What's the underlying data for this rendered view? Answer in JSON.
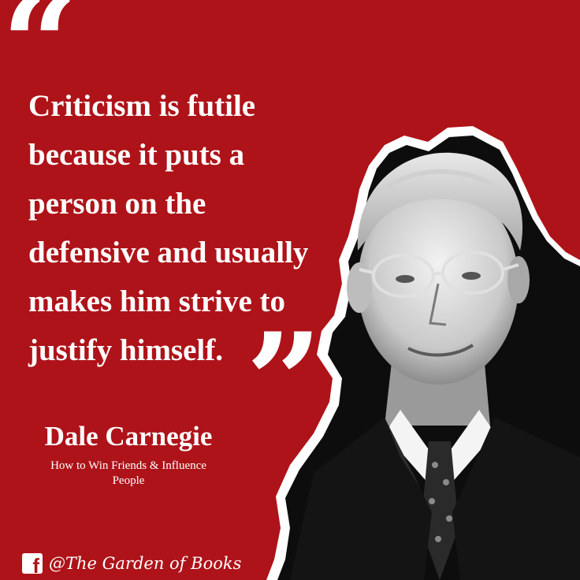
{
  "quote": {
    "open_mark": "“",
    "close_mark": "”",
    "lines": [
      "Criticism is futile",
      "because it puts a",
      "person on the",
      "defensive and usually",
      "makes him strive to",
      "justify himself."
    ]
  },
  "author": {
    "name": "Dale Carnegie",
    "book_line1": "How to Win Friends & Influence",
    "book_line2": "People"
  },
  "social": {
    "icon": "facebook-icon",
    "handle": "@The Garden of Books"
  },
  "colors": {
    "background": "#ae1319",
    "text": "#ffffff",
    "suit": "#121212"
  }
}
